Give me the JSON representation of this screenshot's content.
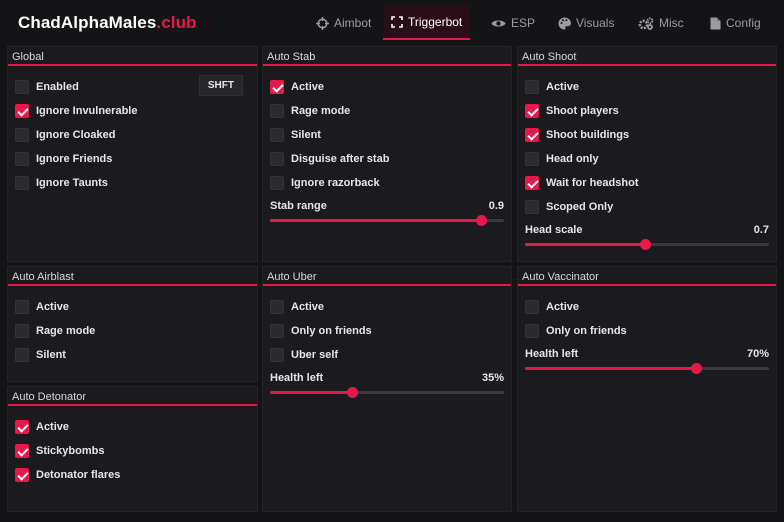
{
  "brand": {
    "name": "ChadAlphaMales",
    "suffix": ".club"
  },
  "colors": {
    "accent": "#e8184a",
    "background": "#141417",
    "panel": "#1b1b1f"
  },
  "tabs": [
    {
      "label": "Aimbot",
      "icon": "crosshair-icon",
      "active": false
    },
    {
      "label": "Triggerbot",
      "icon": "bracket-target-icon",
      "active": true
    },
    {
      "label": "ESP",
      "icon": "eye-icon",
      "active": false
    },
    {
      "label": "Visuals",
      "icon": "palette-icon",
      "active": false
    },
    {
      "label": "Misc",
      "icon": "gears-icon",
      "active": false
    },
    {
      "label": "Config",
      "icon": "file-icon",
      "active": false
    }
  ],
  "global": {
    "title": "Global",
    "keybind": "SHFT",
    "items": [
      {
        "label": "Enabled",
        "checked": false
      },
      {
        "label": "Ignore Invulnerable",
        "checked": true
      },
      {
        "label": "Ignore Cloaked",
        "checked": false
      },
      {
        "label": "Ignore Friends",
        "checked": false
      },
      {
        "label": "Ignore Taunts",
        "checked": false
      }
    ]
  },
  "auto_stab": {
    "title": "Auto Stab",
    "items": [
      {
        "label": "Active",
        "checked": true
      },
      {
        "label": "Rage mode",
        "checked": false
      },
      {
        "label": "Silent",
        "checked": false
      },
      {
        "label": "Disguise after stab",
        "checked": false
      },
      {
        "label": "Ignore razorback",
        "checked": false
      }
    ],
    "slider": {
      "label": "Stab range",
      "value": "0.9",
      "fraction": 0.9
    }
  },
  "auto_shoot": {
    "title": "Auto Shoot",
    "items": [
      {
        "label": "Active",
        "checked": false
      },
      {
        "label": "Shoot players",
        "checked": true
      },
      {
        "label": "Shoot buildings",
        "checked": true
      },
      {
        "label": "Head only",
        "checked": false
      },
      {
        "label": "Wait for headshot",
        "checked": true
      },
      {
        "label": "Scoped Only",
        "checked": false
      }
    ],
    "slider": {
      "label": "Head scale",
      "value": "0.7",
      "fraction": 0.49
    }
  },
  "auto_airblast": {
    "title": "Auto Airblast",
    "items": [
      {
        "label": "Active",
        "checked": false
      },
      {
        "label": "Rage mode",
        "checked": false
      },
      {
        "label": "Silent",
        "checked": false
      }
    ]
  },
  "auto_detonator": {
    "title": "Auto Detonator",
    "items": [
      {
        "label": "Active",
        "checked": true
      },
      {
        "label": "Stickybombs",
        "checked": true
      },
      {
        "label": "Detonator flares",
        "checked": true
      }
    ]
  },
  "auto_uber": {
    "title": "Auto Uber",
    "items": [
      {
        "label": "Active",
        "checked": false
      },
      {
        "label": "Only on friends",
        "checked": false
      },
      {
        "label": "Uber self",
        "checked": false
      }
    ],
    "slider": {
      "label": "Health left",
      "value": "35%",
      "fraction": 0.35
    }
  },
  "auto_vaccinator": {
    "title": "Auto Vaccinator",
    "items": [
      {
        "label": "Active",
        "checked": false
      },
      {
        "label": "Only on friends",
        "checked": false
      }
    ],
    "slider": {
      "label": "Health left",
      "value": "70%",
      "fraction": 0.7
    }
  }
}
